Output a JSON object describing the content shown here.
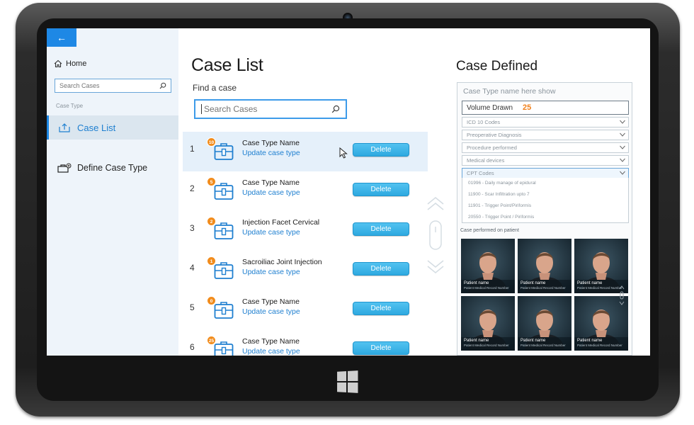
{
  "sidebar": {
    "back_label": "←",
    "home_label": "Home",
    "search_placeholder": "Search Cases",
    "section_label": "Case Type",
    "nav_case_list": "Case List",
    "nav_define": "Define Case Type"
  },
  "main": {
    "title": "Case List",
    "find_label": "Find a case",
    "search_placeholder": "Search Cases",
    "rows": [
      {
        "num": "1",
        "badge": "10",
        "name": "Case Type Name",
        "update": "Update case type",
        "delete": "Delete"
      },
      {
        "num": "2",
        "badge": "5",
        "name": "Case Type Name",
        "update": "Update case type",
        "delete": "Delete"
      },
      {
        "num": "3",
        "badge": "2",
        "name": "Injection Facet Cervical",
        "update": "Update case type",
        "delete": "Delete"
      },
      {
        "num": "4",
        "badge": "1",
        "name": "Sacroiliac Joint Injection",
        "update": "Update case type",
        "delete": "Delete"
      },
      {
        "num": "5",
        "badge": "0",
        "name": "Case Type Name",
        "update": "Update case type",
        "delete": "Delete"
      },
      {
        "num": "6",
        "badge": "25",
        "name": "Case Type Name",
        "update": "Update case type",
        "delete": "Delete"
      }
    ]
  },
  "case_defined": {
    "title": "Case Defined",
    "name_placeholder": "Case Type name here show",
    "volume_label": "Volume Drawn",
    "volume_value": "25",
    "dropdowns": [
      "ICD 10 Codes",
      "Preoperative Diagnosis",
      "Procedure performed",
      "Medical devices",
      "CPT Codes"
    ],
    "cpt_options": [
      "01996 - Daily manage of epidural",
      "11900 - Scar Infiltration upto 7",
      "11901 - Trigger Point/Piriformis",
      "20550 - Trigger Point / Piriformis"
    ],
    "performed_label": "Case performed on patient",
    "patients": [
      {
        "name": "Patient name",
        "sub": "Patient Medical Record Number"
      },
      {
        "name": "Patient name",
        "sub": "Patient Medical Record Number"
      },
      {
        "name": "Patient name",
        "sub": "Patient Medical Record Number"
      },
      {
        "name": "Patient name",
        "sub": "Patient Medical Record Number"
      },
      {
        "name": "Patient name",
        "sub": "Patient Medical Record Number"
      },
      {
        "name": "Patient name",
        "sub": "Patient Medical Record Number"
      }
    ]
  },
  "colors": {
    "accent": "#1e88e5",
    "badge": "#f28c1c",
    "delete_button": "#2ea9e0",
    "volume_value": "#f07f1a"
  },
  "icons": [
    "back-arrow-icon",
    "home-icon",
    "search-icon",
    "upload-icon",
    "define-case-icon",
    "medical-kit-icon",
    "chevron-down-icon",
    "cursor-icon",
    "scroll-up-icon",
    "scroll-down-icon",
    "windows-logo-icon"
  ]
}
